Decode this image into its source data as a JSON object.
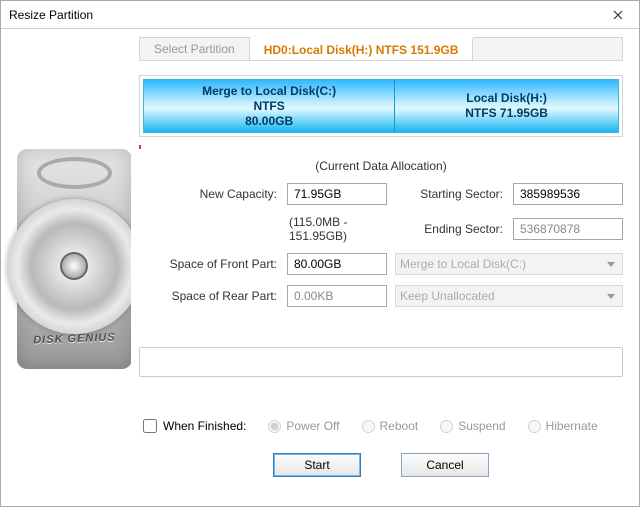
{
  "window": {
    "title": "Resize Partition"
  },
  "tabs": {
    "select_label": "Select Partition",
    "active_label": "HD0:Local Disk(H:) NTFS 151.9GB"
  },
  "segments": [
    {
      "title": "Merge to Local Disk(C:)",
      "fs": "NTFS",
      "size": "80.00GB",
      "widthPct": 53
    },
    {
      "title": "Local Disk(H:)",
      "fs": "NTFS 71.95GB",
      "size": "",
      "widthPct": 47
    }
  ],
  "allocation_title": "(Current Data Allocation)",
  "fields": {
    "new_capacity_label": "New Capacity:",
    "new_capacity_value": "71.95GB",
    "range_hint": "(115.0MB - 151.95GB)",
    "starting_sector_label": "Starting Sector:",
    "starting_sector_value": "385989536",
    "ending_sector_label": "Ending Sector:",
    "ending_sector_value": "536870878",
    "front_label": "Space of Front Part:",
    "front_value": "80.00GB",
    "front_select": "Merge to Local Disk(C:)",
    "rear_label": "Space of Rear Part:",
    "rear_value": "0.00KB",
    "rear_select": "Keep Unallocated"
  },
  "finish": {
    "label": "When Finished:",
    "options": [
      "Power Off",
      "Reboot",
      "Suspend",
      "Hibernate"
    ]
  },
  "buttons": {
    "start": "Start",
    "cancel": "Cancel"
  },
  "sidebar_text": "DISK GENIUS"
}
